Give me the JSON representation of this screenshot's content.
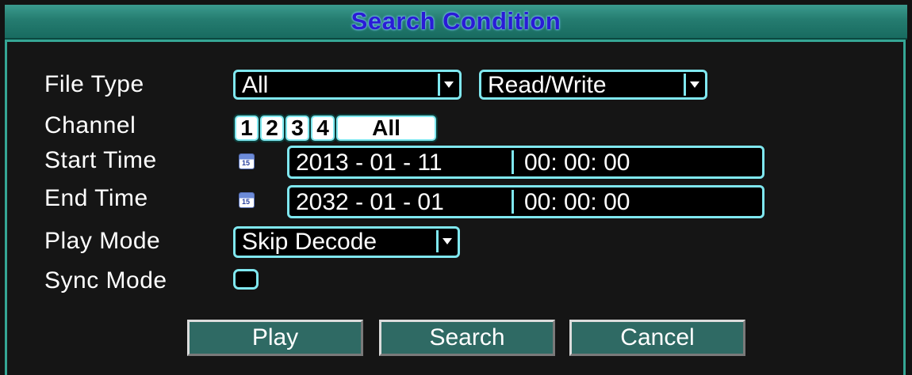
{
  "title": "Search Condition",
  "labels": {
    "file_type": "File Type",
    "channel": "Channel",
    "start_time": "Start Time",
    "end_time": "End Time",
    "play_mode": "Play Mode",
    "sync_mode": "Sync Mode"
  },
  "file_type": {
    "value": "All",
    "access": "Read/Write"
  },
  "channels": [
    "1",
    "2",
    "3",
    "4",
    "All"
  ],
  "start_time": {
    "date": "2013 - 01 - 11",
    "time": "00: 00: 00"
  },
  "end_time": {
    "date": "2032 - 01 - 01",
    "time": "00: 00: 00"
  },
  "play_mode": {
    "value": "Skip Decode"
  },
  "sync_mode": {
    "checked": false
  },
  "buttons": {
    "play": "Play",
    "search": "Search",
    "cancel": "Cancel"
  },
  "colors": {
    "accent": "#7fe7ef",
    "title_bar": "#257c70",
    "title_text": "#2a1bd6",
    "button": "#2f6a64"
  }
}
